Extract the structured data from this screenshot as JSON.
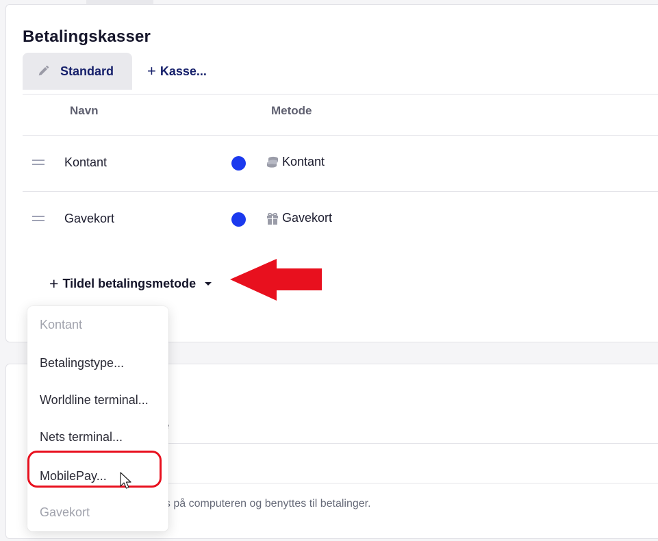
{
  "section": {
    "title": "Betalingskasser"
  },
  "tabs": [
    {
      "label": "Standard",
      "icon": "pencil-icon",
      "active": true
    },
    {
      "label": "Kasse...",
      "icon": "plus-icon",
      "prefix": "+"
    }
  ],
  "table": {
    "columns": [
      "Navn",
      "Metode"
    ],
    "rows": [
      {
        "name": "Kontant",
        "color": "#1b39ee",
        "method": "Kontant",
        "method_icon": "coins-icon"
      },
      {
        "name": "Gavekort",
        "color": "#1b39ee",
        "method": "Gavekort",
        "method_icon": "gift-icon"
      }
    ]
  },
  "assign": {
    "prefix": "+",
    "label": "Tildel betalingsmetode"
  },
  "dropdown": {
    "items": [
      {
        "label": "Kontant",
        "enabled": false
      },
      {
        "label": "Betalingstype...",
        "enabled": true
      },
      {
        "label": "Worldline terminal...",
        "enabled": true
      },
      {
        "label": "Nets terminal...",
        "enabled": true
      },
      {
        "label": "MobilePay...",
        "enabled": true,
        "highlighted": true
      },
      {
        "label": "Gavekort",
        "enabled": false
      }
    ]
  },
  "card2": {
    "partial_heading_tail": "e",
    "partial_hint": "es på computeren og benyttes til betalinger."
  },
  "colors": {
    "accent": "#16206b",
    "dot": "#1b39ee",
    "annotation": "#e8101e"
  }
}
